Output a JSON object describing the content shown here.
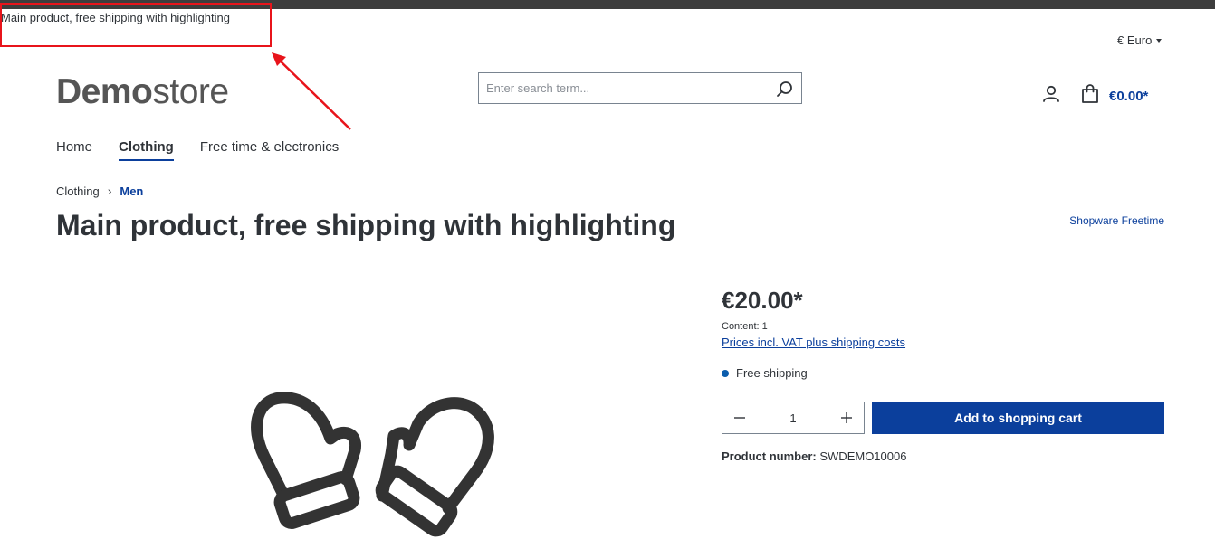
{
  "annotation": {
    "tooltip_text": "Main product, free shipping with highlighting"
  },
  "header": {
    "currency_label": "€ Euro",
    "logo_bold": "Demo",
    "logo_light": "store",
    "search_placeholder": "Enter search term...",
    "search_icon": "search-icon",
    "account_icon": "user-icon",
    "cart_icon": "shopping-bag-icon",
    "cart_total": "€0.00*"
  },
  "nav": {
    "items": [
      {
        "label": "Home"
      },
      {
        "label": "Clothing",
        "active": true
      },
      {
        "label": "Free time & electronics"
      }
    ]
  },
  "breadcrumb": {
    "items": [
      "Clothing",
      "Men"
    ]
  },
  "product": {
    "title": "Main product, free shipping with highlighting",
    "manufacturer": "Shopware Freetime",
    "price": "€20.00*",
    "content": "Content: 1",
    "vat_link": "Prices incl. VAT plus shipping costs",
    "shipping": "Free shipping",
    "quantity": "1",
    "add_to_cart_label": "Add to shopping cart",
    "product_number_label": "Product number:",
    "product_number_value": "SWDEMO10006",
    "image_icon": "mittens-icon"
  },
  "colors": {
    "primary": "#0b3f9c",
    "annotation_red": "#e8141b",
    "text": "#2f3338"
  }
}
